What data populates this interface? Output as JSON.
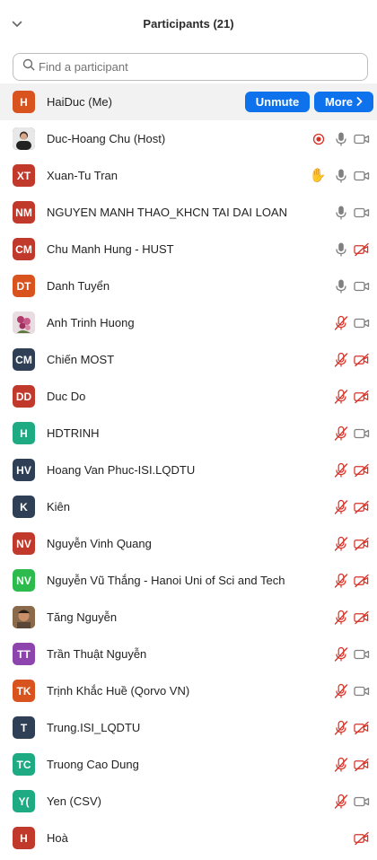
{
  "header": {
    "title": "Participants (21)"
  },
  "search": {
    "placeholder": "Find a participant"
  },
  "actions": {
    "unmute_label": "Unmute",
    "more_label": "More"
  },
  "colors": {
    "accent": "#0e72ed",
    "muted_red": "#d93025",
    "icon_gray": "#7a7a7a"
  },
  "participants": [
    {
      "name": "HaiDuc (Me)",
      "initials": "H",
      "color": "#d9531e",
      "is_me": true,
      "mic": "none",
      "cam": "none"
    },
    {
      "name": "Duc-Hoang Chu (Host)",
      "initials": "",
      "photo": "man",
      "color": "#555555",
      "recording": true,
      "mic": "on",
      "cam": "on"
    },
    {
      "name": "Xuan-Tu Tran",
      "initials": "XT",
      "color": "#c0392b",
      "hand": true,
      "mic": "on",
      "cam": "on"
    },
    {
      "name": "NGUYEN MANH THAO_KHCN TAI DAI LOAN",
      "initials": "NM",
      "color": "#c0392b",
      "mic": "on",
      "cam": "on"
    },
    {
      "name": "Chu Manh Hung - HUST",
      "initials": "CM",
      "color": "#c0392b",
      "mic": "on",
      "cam": "off"
    },
    {
      "name": "Danh Tuyển",
      "initials": "DT",
      "color": "#d9531e",
      "mic": "on",
      "cam": "on"
    },
    {
      "name": "Anh Trinh Huong",
      "initials": "",
      "photo": "flower",
      "color": "#c9a0b0",
      "mic": "off",
      "cam": "on"
    },
    {
      "name": "Chiến MOST",
      "initials": "CM",
      "color": "#2f3f55",
      "mic": "off",
      "cam": "off"
    },
    {
      "name": "Duc Do",
      "initials": "DD",
      "color": "#c0392b",
      "mic": "off",
      "cam": "off"
    },
    {
      "name": "HDTRINH",
      "initials": "H",
      "color": "#1eaa82",
      "mic": "off",
      "cam": "on"
    },
    {
      "name": "Hoang Van Phuc-ISI.LQDTU",
      "initials": "HV",
      "color": "#2f3f55",
      "mic": "off",
      "cam": "off"
    },
    {
      "name": "Kiên",
      "initials": "K",
      "color": "#2f3f55",
      "mic": "off",
      "cam": "off"
    },
    {
      "name": "Nguyễn Vinh Quang",
      "initials": "NV",
      "color": "#c0392b",
      "mic": "off",
      "cam": "off"
    },
    {
      "name": "Nguyễn Vũ Thắng - Hanoi Uni of Sci and Tech",
      "initials": "NV",
      "color": "#2dbb4e",
      "mic": "off",
      "cam": "off"
    },
    {
      "name": "Tăng Nguyễn",
      "initials": "",
      "photo": "man2",
      "color": "#8a6a4a",
      "mic": "off",
      "cam": "off"
    },
    {
      "name": "Trần Thuật Nguyễn",
      "initials": "TT",
      "color": "#8e44ad",
      "mic": "off",
      "cam": "on"
    },
    {
      "name": "Trịnh Khắc Huề (Qorvo VN)",
      "initials": "TK",
      "color": "#d9531e",
      "mic": "off",
      "cam": "on"
    },
    {
      "name": "Trung.ISI_LQDTU",
      "initials": "T",
      "color": "#2f3f55",
      "mic": "off",
      "cam": "off"
    },
    {
      "name": "Truong Cao Dung",
      "initials": "TC",
      "color": "#1eaa82",
      "mic": "off",
      "cam": "off"
    },
    {
      "name": "Yen (CSV)",
      "initials": "Y(",
      "color": "#1eaa82",
      "mic": "off",
      "cam": "on"
    },
    {
      "name": "Hoà",
      "initials": "H",
      "color": "#c0392b",
      "mic": "none",
      "cam": "off"
    }
  ]
}
